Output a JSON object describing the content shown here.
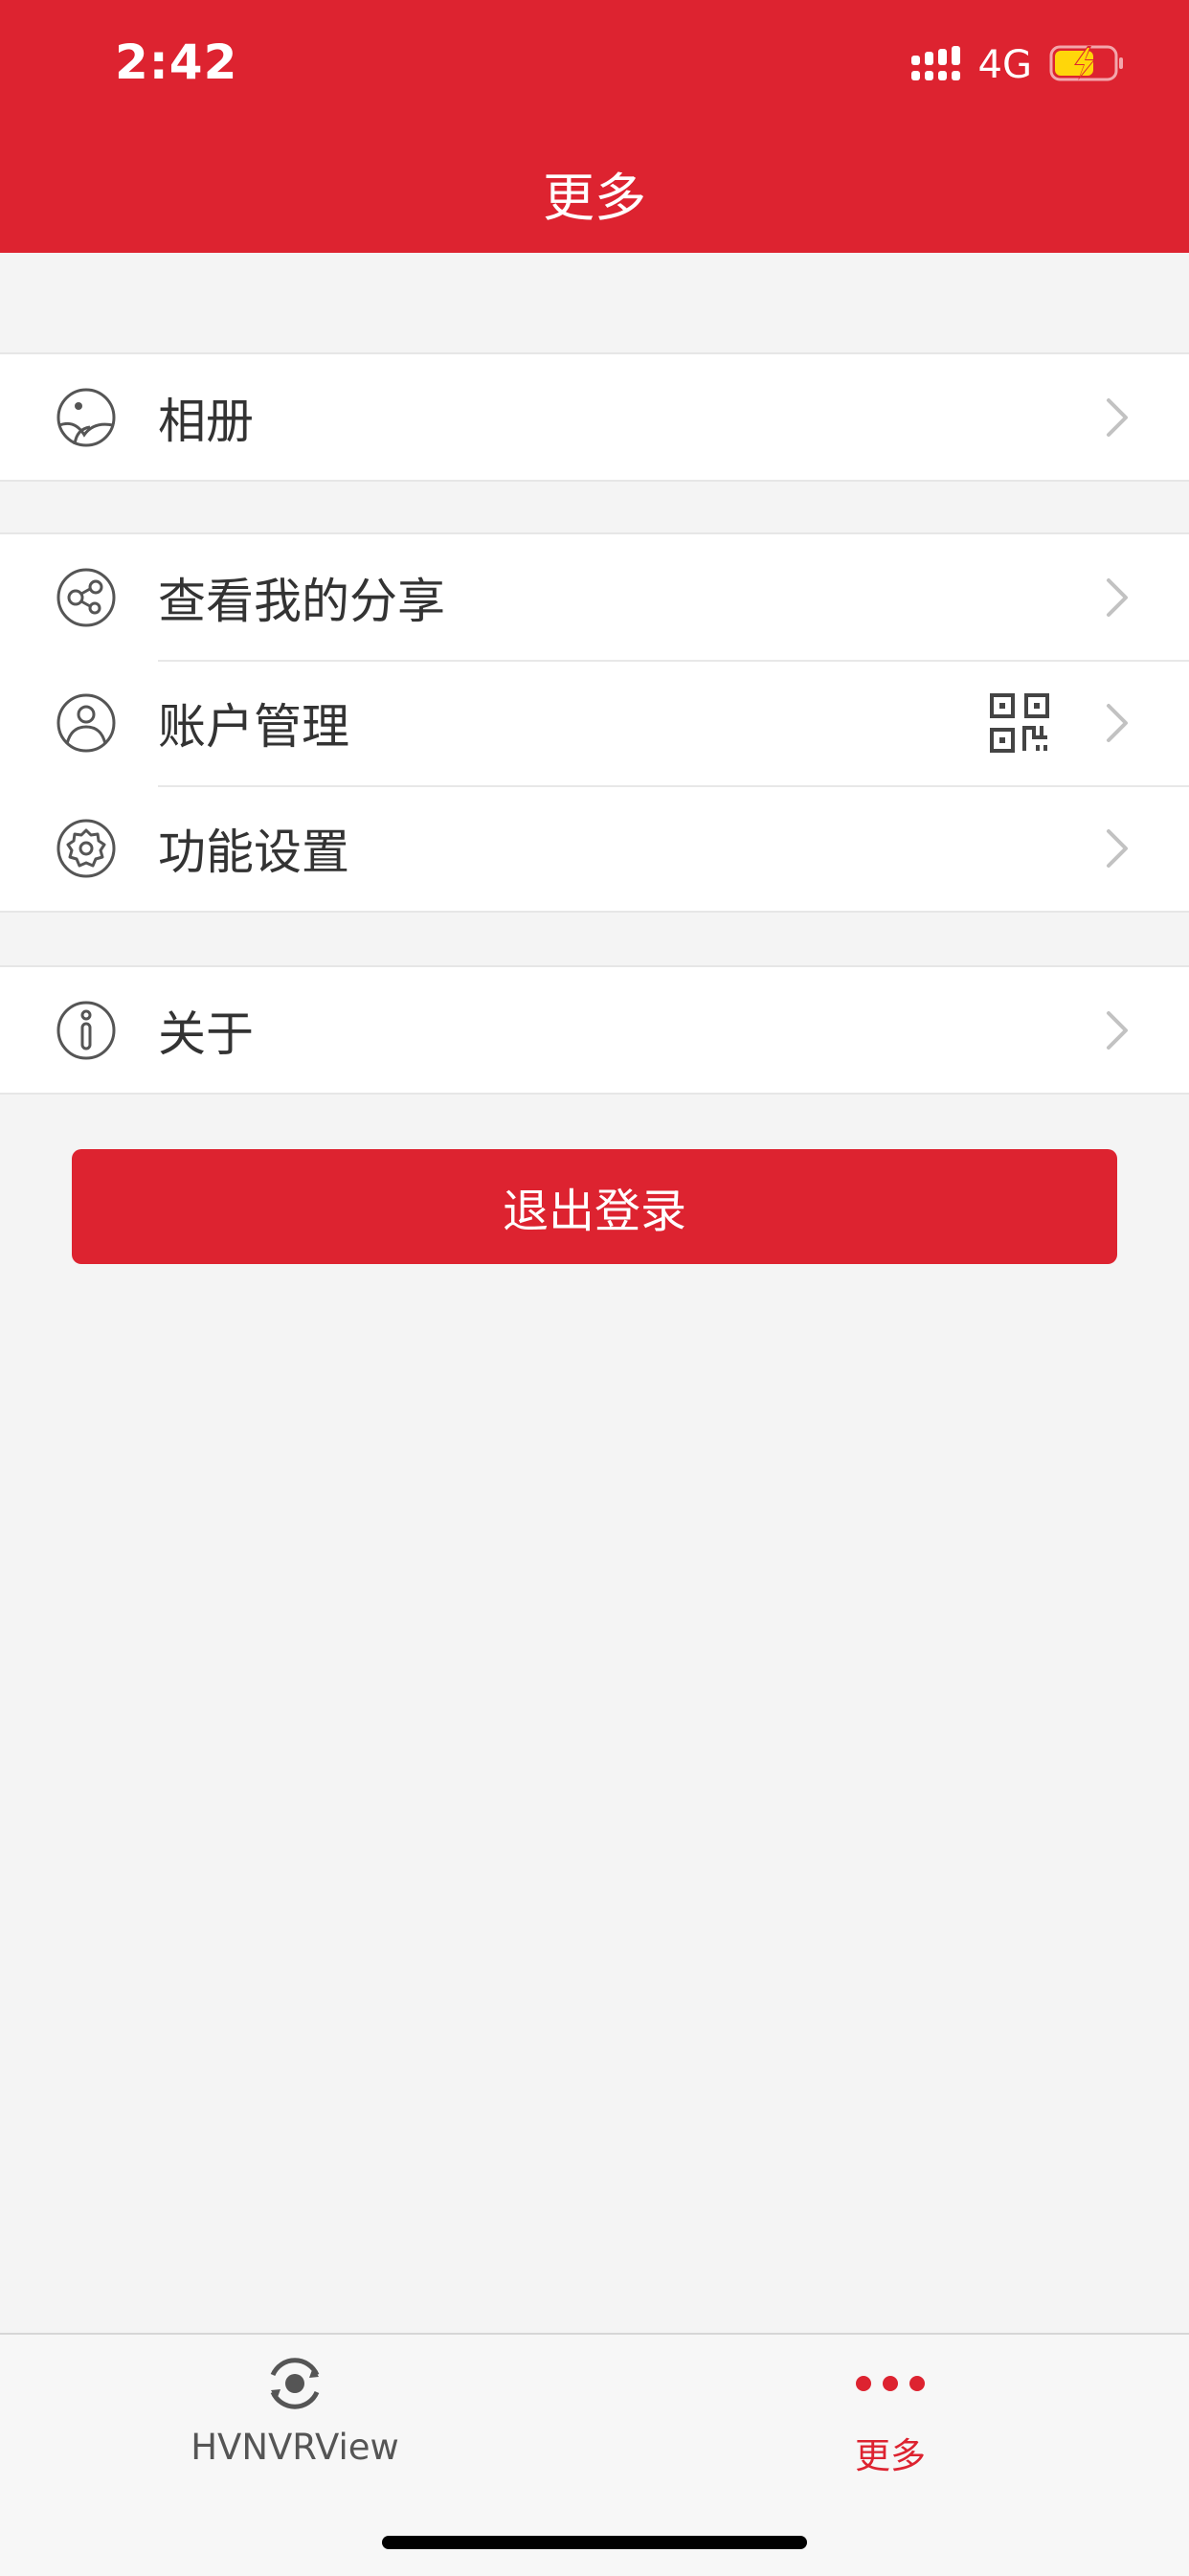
{
  "status_bar": {
    "time": "2:42",
    "network": "4G"
  },
  "nav": {
    "title": "更多"
  },
  "menu": {
    "album": "相册",
    "my_shares": "查看我的分享",
    "account": "账户管理",
    "settings": "功能设置",
    "about": "关于"
  },
  "logout": {
    "label": "退出登录"
  },
  "tabbar": {
    "tabs": [
      {
        "label": "HVNVRView",
        "icon": "camera-view-icon",
        "active": false
      },
      {
        "label": "更多",
        "icon": "more-dots-icon",
        "active": true
      }
    ]
  },
  "colors": {
    "accent": "#dd2330",
    "background": "#f4f4f4",
    "battery": "#ffd60a"
  }
}
